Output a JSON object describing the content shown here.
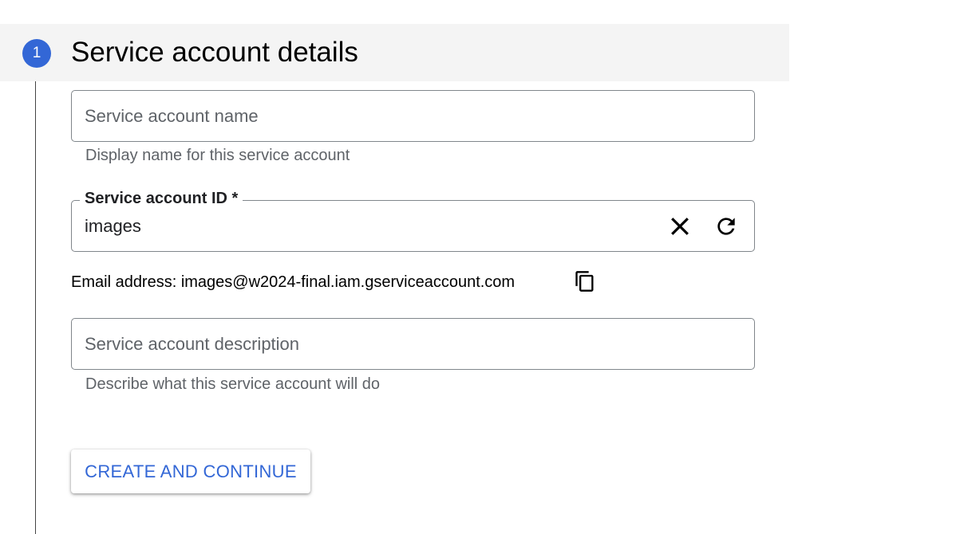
{
  "step": {
    "number": "1",
    "title": "Service account details",
    "accent_color": "#3367d6"
  },
  "service_account_name": {
    "value": "",
    "placeholder": "Service account name",
    "helper": "Display name for this service account"
  },
  "service_account_id": {
    "label": "Service account ID *",
    "value": "images",
    "clear_icon": "close-icon",
    "refresh_icon": "refresh-icon"
  },
  "email": {
    "text": "Email address: images@w2024-final.iam.gserviceaccount.com",
    "copy_icon": "copy-icon"
  },
  "service_account_description": {
    "value": "",
    "placeholder": "Service account description",
    "helper": "Describe what this service account will do"
  },
  "actions": {
    "create_label": "CREATE AND CONTINUE"
  }
}
